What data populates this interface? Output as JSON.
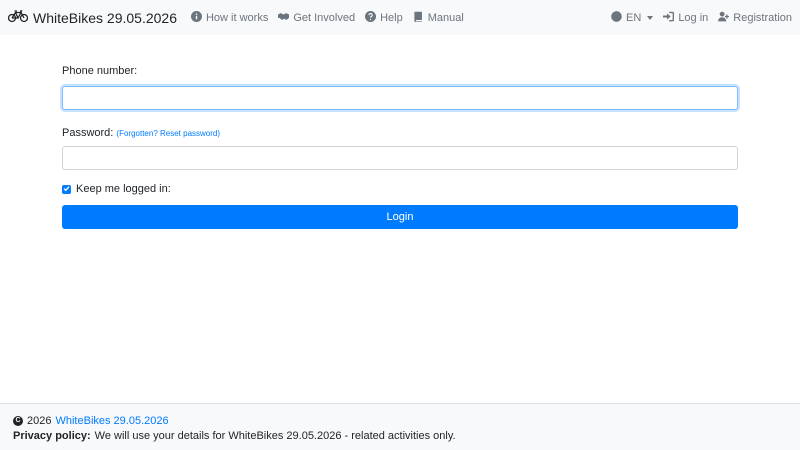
{
  "nav": {
    "brand": "WhiteBikes 29.05.2026",
    "how_it_works": "How it works",
    "get_involved": "Get Involved",
    "help": "Help",
    "manual": "Manual",
    "language": "EN",
    "login": "Log in",
    "registration": "Registration"
  },
  "form": {
    "phone_label": "Phone number:",
    "phone_value": "",
    "password_label": "Password:",
    "forgot_link": "(Forgotten? Reset password)",
    "password_value": "",
    "keep_logged_label": "Keep me logged in:",
    "keep_logged_checked": true,
    "login_button": "Login"
  },
  "footer": {
    "year": "2026",
    "site_link": "WhiteBikes 29.05.2026",
    "privacy_label": "Privacy policy:",
    "privacy_text": "We will use your details for WhiteBikes 29.05.2026 - related activities only."
  },
  "colors": {
    "accent": "#007bff",
    "navbar_bg": "#f8f9fa",
    "muted": "#6c757d"
  },
  "icons": [
    "bicycle-icon",
    "info-circle-icon",
    "handshake-icon",
    "question-circle-icon",
    "book-icon",
    "globe-icon",
    "sign-in-icon",
    "user-plus-icon",
    "check-icon",
    "copyright-icon"
  ]
}
